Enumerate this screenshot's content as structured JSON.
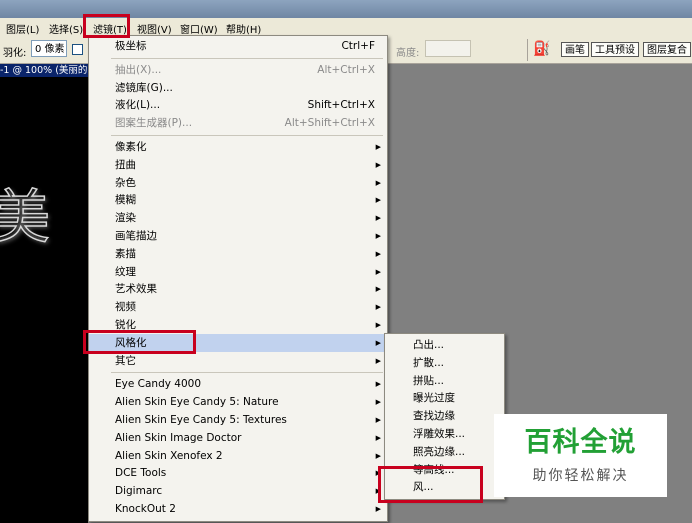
{
  "menubar": {
    "items": [
      "图层(L)",
      "选择(S)",
      "滤镜(T)",
      "视图(V)",
      "窗口(W)",
      "帮助(H)"
    ]
  },
  "options": {
    "feather_label": "羽化:",
    "feather_value": "0 像素",
    "height_label": "高度:",
    "panel_tabs": [
      "画笔",
      "工具预设",
      "图层复合"
    ]
  },
  "document": {
    "title": "-1 @ 100% (美丽的"
  },
  "filter_menu": {
    "groups": [
      [
        {
          "label": "极坐标",
          "shortcut": "Ctrl+F",
          "disabled": false
        }
      ],
      [
        {
          "label": "抽出(X)...",
          "shortcut": "Alt+Ctrl+X",
          "disabled": true
        },
        {
          "label": "滤镜库(G)...",
          "shortcut": "",
          "disabled": false
        },
        {
          "label": "液化(L)...",
          "shortcut": "Shift+Ctrl+X",
          "disabled": false
        },
        {
          "label": "图案生成器(P)...",
          "shortcut": "Alt+Shift+Ctrl+X",
          "disabled": true
        }
      ],
      [
        {
          "label": "像素化",
          "submenu": true
        },
        {
          "label": "扭曲",
          "submenu": true
        },
        {
          "label": "杂色",
          "submenu": true
        },
        {
          "label": "模糊",
          "submenu": true
        },
        {
          "label": "渲染",
          "submenu": true
        },
        {
          "label": "画笔描边",
          "submenu": true
        },
        {
          "label": "素描",
          "submenu": true
        },
        {
          "label": "纹理",
          "submenu": true
        },
        {
          "label": "艺术效果",
          "submenu": true
        },
        {
          "label": "视频",
          "submenu": true
        },
        {
          "label": "锐化",
          "submenu": true
        },
        {
          "label": "风格化",
          "submenu": true,
          "highlighted": true
        },
        {
          "label": "其它",
          "submenu": true
        }
      ],
      [
        {
          "label": "Eye Candy 4000",
          "submenu": true
        },
        {
          "label": "Alien Skin Eye Candy 5: Nature",
          "submenu": true
        },
        {
          "label": "Alien Skin Eye Candy 5: Textures",
          "submenu": true
        },
        {
          "label": "Alien Skin Image Doctor",
          "submenu": true
        },
        {
          "label": "Alien Skin Xenofex 2",
          "submenu": true
        },
        {
          "label": "DCE Tools",
          "submenu": true
        },
        {
          "label": "Digimarc",
          "submenu": true
        },
        {
          "label": "KnockOut 2",
          "submenu": true
        }
      ]
    ]
  },
  "stylize_submenu": {
    "items": [
      "凸出...",
      "扩散...",
      "拼贴...",
      "曝光过度",
      "查找边缘",
      "浮雕效果...",
      "照亮边缘...",
      "等高线...",
      "风..."
    ]
  },
  "watermark": {
    "main": "百科全说",
    "sub": "助你轻松解决"
  },
  "colors": {
    "highlight": "#c1d2ee",
    "annotation_red": "#c8001e",
    "watermark_green": "#22a035"
  },
  "canvas_glyph": "美"
}
